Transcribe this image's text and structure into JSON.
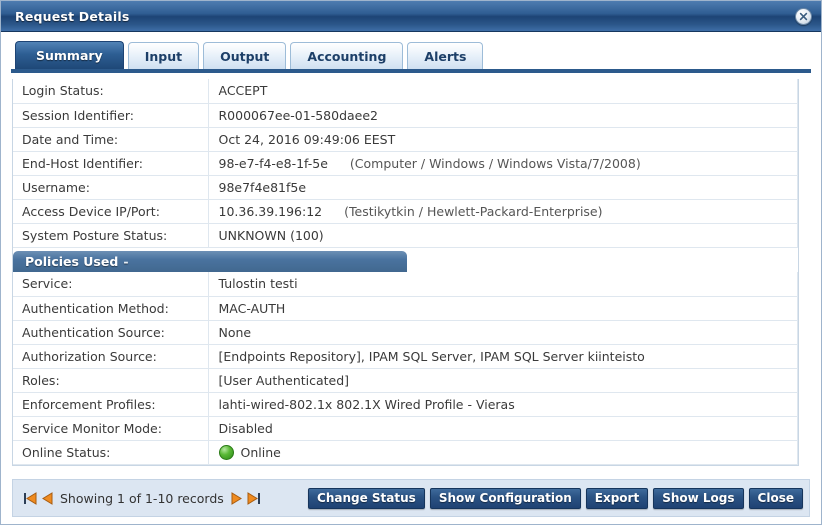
{
  "window": {
    "title": "Request Details",
    "close_icon": "close-circle-icon"
  },
  "tabs": [
    {
      "label": "Summary",
      "active": true
    },
    {
      "label": "Input",
      "active": false
    },
    {
      "label": "Output",
      "active": false
    },
    {
      "label": "Accounting",
      "active": false
    },
    {
      "label": "Alerts",
      "active": false
    }
  ],
  "summary_rows": [
    {
      "label": "Login Status:",
      "value": "ACCEPT",
      "extra": ""
    },
    {
      "label": "Session Identifier:",
      "value": "R000067ee-01-580daee2",
      "extra": ""
    },
    {
      "label": "Date and Time:",
      "value": "Oct 24, 2016 09:49:06 EEST",
      "extra": ""
    },
    {
      "label": "End-Host Identifier:",
      "value": "98-e7-f4-e8-1f-5e",
      "extra": "(Computer / Windows / Windows Vista/7/2008)"
    },
    {
      "label": "Username:",
      "value": "98e7f4e81f5e",
      "extra": ""
    },
    {
      "label": "Access Device IP/Port:",
      "value": "10.36.39.196:12",
      "extra": "(Testikytkin / Hewlett-Packard-Enterprise)"
    },
    {
      "label": "System Posture Status:",
      "value": "UNKNOWN (100)",
      "extra": ""
    }
  ],
  "policies_section": {
    "title": "Policies Used",
    "collapse_glyph": "-"
  },
  "policy_rows": [
    {
      "label": "Service:",
      "value": "Tulostin testi",
      "extra": ""
    },
    {
      "label": "Authentication Method:",
      "value": "MAC-AUTH",
      "extra": ""
    },
    {
      "label": "Authentication Source:",
      "value": "None",
      "extra": ""
    },
    {
      "label": "Authorization Source:",
      "value": "[Endpoints Repository], IPAM SQL Server, IPAM SQL Server kiinteisto",
      "extra": ""
    },
    {
      "label": "Roles:",
      "value": "[User Authenticated]",
      "extra": ""
    },
    {
      "label": "Enforcement Profiles:",
      "value": "lahti-wired-802.1x 802.1X Wired Profile - Vieras",
      "extra": ""
    },
    {
      "label": "Service Monitor Mode:",
      "value": "Disabled",
      "extra": ""
    }
  ],
  "online_status": {
    "label": "Online Status:",
    "value": "Online",
    "dot_color": "#59b836"
  },
  "footer": {
    "pager": {
      "first_icon": "first-page-icon",
      "prev_icon": "previous-page-icon",
      "text": "Showing 1 of 1-10 records",
      "next_icon": "next-page-icon",
      "last_icon": "last-page-icon"
    },
    "buttons": [
      {
        "label": "Change Status"
      },
      {
        "label": "Show Configuration"
      },
      {
        "label": "Export"
      },
      {
        "label": "Show Logs"
      },
      {
        "label": "Close"
      }
    ]
  },
  "colors": {
    "title_bar": "#2f5d92",
    "accent": "#1f4273",
    "tab_active": "#2d5e93",
    "pager_arrow": "#ef8b20",
    "footer_bg": "#dce6f2"
  }
}
